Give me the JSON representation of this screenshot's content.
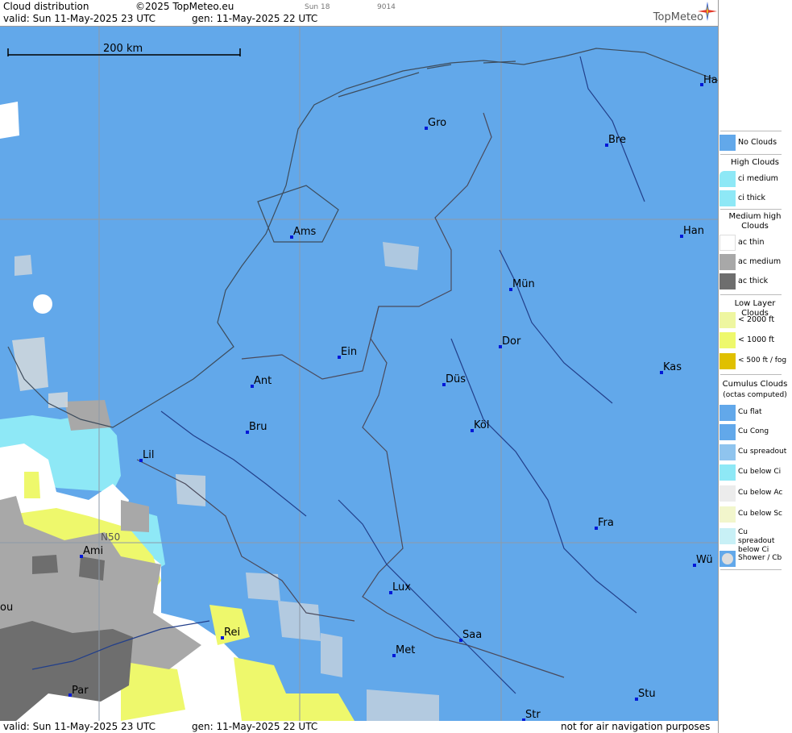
{
  "header": {
    "product": "Cloud distribution",
    "copyright": "©2025 TopMeteo.eu",
    "small_label_1": "Sun 18",
    "small_label_2": "9014",
    "valid": "valid:  Sun  11-May-2025  23 UTC",
    "gen": "gen: 11-May-2025 22 UTC",
    "logo": "TopMeteo"
  },
  "map": {
    "scale_label": "200 km",
    "latitude_label": "N50",
    "cities": [
      "Ha",
      "Gro",
      "Bre",
      "Han",
      "Ams",
      "Mün",
      "Dor",
      "Ein",
      "Ant",
      "Düs",
      "Kas",
      "Bru",
      "Köl",
      "Lil",
      "Fra",
      "Ami",
      "Wü",
      "ou",
      "Lux",
      "Rei",
      "Saa",
      "Met",
      "Par",
      "Stu",
      "Str"
    ]
  },
  "footer": {
    "valid": "valid:  Sun  11-May-2025  23 UTC",
    "gen": "gen: 11-May-2025 22 UTC",
    "disclaimer": "not for air navigation purposes"
  },
  "legend": {
    "no_clouds": "No Clouds",
    "high_title": "High Clouds",
    "ci_medium": "ci medium",
    "ci_thick": "ci thick",
    "medium_title": "Medium high Clouds",
    "ac_thin": "ac thin",
    "ac_medium": "ac medium",
    "ac_thick": "ac thick",
    "low_title": "Low Layer Clouds",
    "low_2000": "< 2000 ft",
    "low_1000": "< 1000 ft",
    "low_500": "< 500 ft / fog",
    "cumulus_title": "Cumulus Clouds",
    "cumulus_sub": "(octas computed)",
    "cu_flat": "Cu flat",
    "cu_cong": "Cu Cong",
    "cu_spreadout": "Cu spreadout",
    "cu_below_ci": "Cu below Ci",
    "cu_below_ac": "Cu below Ac",
    "cu_below_sc": "Cu below Sc",
    "cu_spreadout_below_ci": "Cu spreadout below Ci",
    "shower_cb": "Shower / Cb"
  },
  "colors": {
    "no_clouds": "#62a8ea",
    "ci": "#8ee8f6",
    "ac_thin": "#ffffff",
    "ac_medium": "#a8a8a8",
    "ac_thick": "#6e6e6e",
    "low_2000": "#eef6a0",
    "low_1000": "#eef86c",
    "low_500": "#e0c000"
  }
}
